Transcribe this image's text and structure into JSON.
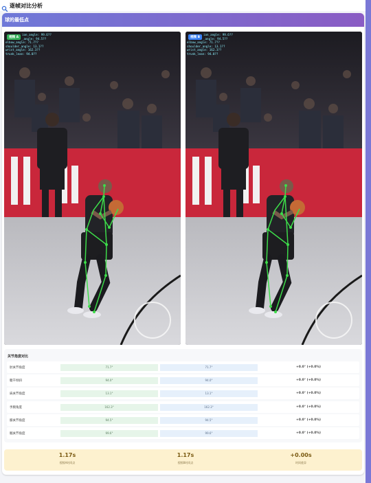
{
  "app": {
    "title": "逐帧对比分析",
    "icon": "search-icon"
  },
  "section": {
    "title": "球的最低点"
  },
  "frames": {
    "left": {
      "badge": "视频 A",
      "badge_color": "#36b25a",
      "overlay_lines": [
        "ion_angle: 99.6??",
        "_angle: 94.5??",
        "elbow_angle: 71.7??",
        "shoulder_angle: 13.1??",
        "wrist_angle: 162.3??",
        "trunk_lean: 94.0??"
      ]
    },
    "right": {
      "badge": "视频 B",
      "badge_color": "#3b82f6",
      "overlay_lines": [
        "ion_angle: 99.6??",
        "_angle: 94.5??",
        "elbow_angle: 71.7??",
        "shoulder_angle: 13.1??",
        "wrist_angle: 162.3??",
        "trunk_lean: 94.0??"
      ]
    }
  },
  "comparison": {
    "title": "关节角度对比",
    "rows": [
      {
        "label": "肘关节角度",
        "a": "71.7°",
        "b": "71.7°",
        "diff": "+0.0° (+0.0%)"
      },
      {
        "label": "躯干倾斜",
        "a": "94.0°",
        "b": "94.0°",
        "diff": "+0.0° (+0.0%)"
      },
      {
        "label": "肩关节角度",
        "a": "13.1°",
        "b": "13.1°",
        "diff": "+0.0° (+0.0%)"
      },
      {
        "label": "手腕角度",
        "a": "162.3°",
        "b": "162.3°",
        "diff": "+0.0° (+0.0%)"
      },
      {
        "label": "膝关节角度",
        "a": "94.5°",
        "b": "94.5°",
        "diff": "+0.0° (+0.0%)"
      },
      {
        "label": "髋关节角度",
        "a": "99.6°",
        "b": "99.6°",
        "diff": "+0.0° (+0.0%)"
      }
    ]
  },
  "summary": [
    {
      "value": "1.17s",
      "label": "视频A时间点"
    },
    {
      "value": "1.17s",
      "label": "视频B时间点"
    },
    {
      "value": "+0.00s",
      "label": "时间差异"
    }
  ],
  "colors": {
    "header_start": "#6f79d8",
    "header_end": "#8a5cc4",
    "skeleton": "#3ddc4a",
    "summary_bg": "#fdf1cf"
  }
}
